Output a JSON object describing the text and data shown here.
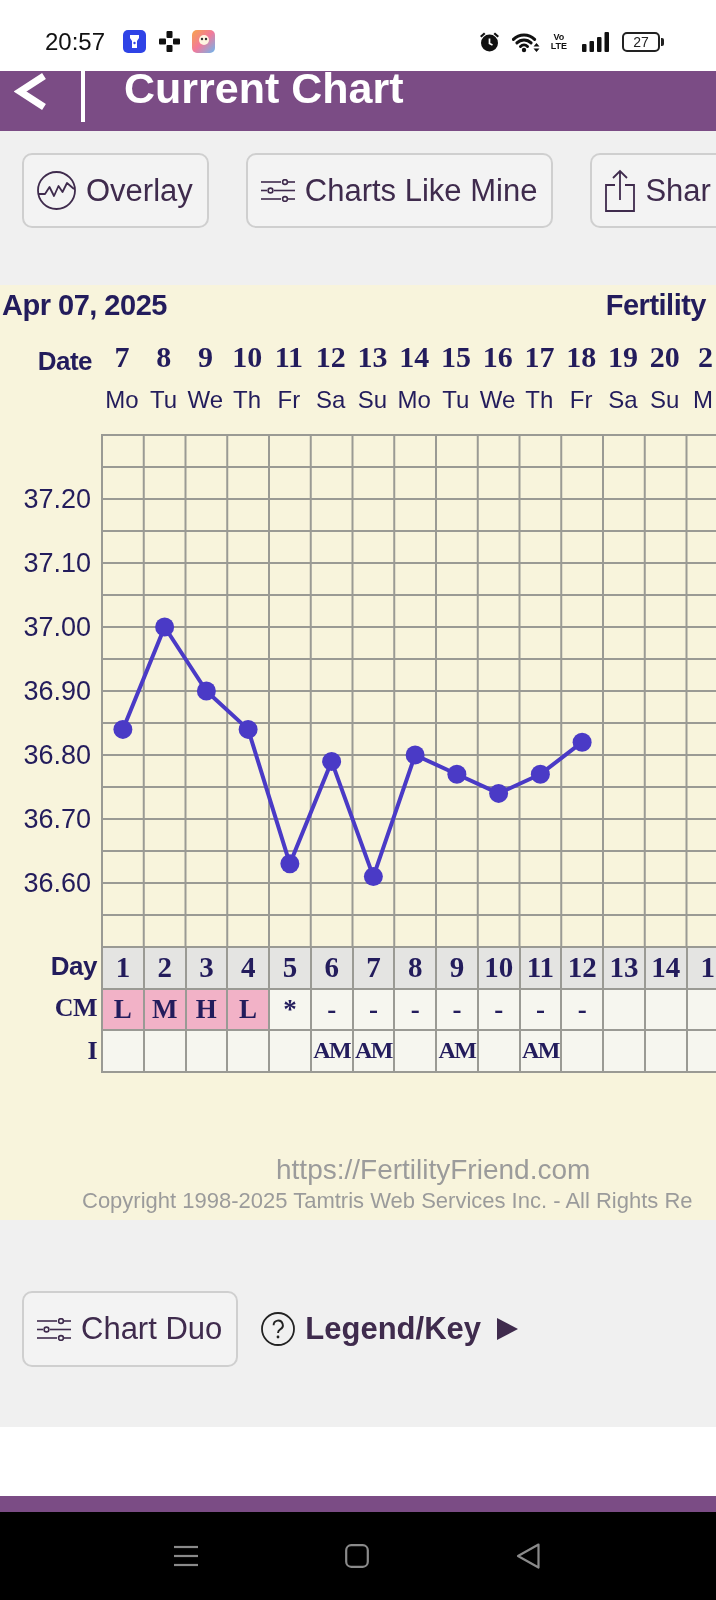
{
  "status_bar": {
    "time": "20:57",
    "network_type": [
      "Vo",
      "LTE"
    ],
    "battery": "27"
  },
  "header": {
    "title": "Current Chart"
  },
  "toolbar": [
    {
      "kind": "overlay",
      "label": "Overlay"
    },
    {
      "kind": "sliders",
      "label": "Charts Like Mine"
    },
    {
      "kind": "share",
      "label": "Shar"
    }
  ],
  "chart": {
    "date": "Apr 07, 2025",
    "brand": "Fertility",
    "date_label": "Date",
    "weekdays": [
      "Mo",
      "Tu",
      "We",
      "Th",
      "Fr",
      "Sa",
      "Su",
      "Mo",
      "Tu",
      "We",
      "Th",
      "Fr",
      "Sa",
      "Su",
      "M"
    ],
    "chart_data": {
      "type": "line",
      "grid": true,
      "categories": [
        "7",
        "8",
        "9",
        "10",
        "11",
        "12",
        "13",
        "14",
        "15",
        "16",
        "17",
        "18",
        "19",
        "20",
        "2"
      ],
      "series": [
        {
          "color": "#4a3ac6",
          "marker": true,
          "values": [
            36.84,
            37.0,
            36.9,
            36.84,
            36.63,
            36.79,
            36.61,
            36.8,
            36.77,
            36.74,
            36.77,
            36.82,
            null,
            null,
            null
          ]
        }
      ],
      "ylim": [
        36.5,
        37.3
      ],
      "yticks": [
        {
          "value": 36.6,
          "label": "36.60"
        },
        {
          "value": 36.7,
          "label": "36.70"
        },
        {
          "value": 36.8,
          "label": "36.80"
        },
        {
          "value": 36.9,
          "label": "36.90"
        },
        {
          "value": 37.0,
          "label": "37.00"
        },
        {
          "value": 37.1,
          "label": "37.10"
        },
        {
          "value": 37.2,
          "label": "37.20"
        }
      ]
    },
    "rows": [
      {
        "kind": "day",
        "label": "Day",
        "cells": [
          {
            "text": "1"
          },
          {
            "text": "2"
          },
          {
            "text": "3"
          },
          {
            "text": "4"
          },
          {
            "text": "5"
          },
          {
            "text": "6"
          },
          {
            "text": "7"
          },
          {
            "text": "8"
          },
          {
            "text": "9"
          },
          {
            "text": "10"
          },
          {
            "text": "11"
          },
          {
            "text": "12"
          },
          {
            "text": "13"
          },
          {
            "text": "14"
          },
          {
            "text": "1"
          }
        ]
      },
      {
        "kind": "cm",
        "label": "CM",
        "cells": [
          {
            "text": "L",
            "highlighted": true
          },
          {
            "text": "M",
            "highlighted": true
          },
          {
            "text": "H",
            "highlighted": true
          },
          {
            "text": "L",
            "highlighted": true
          },
          {
            "text": "*",
            "highlighted": false
          },
          {
            "text": "-",
            "highlighted": false
          },
          {
            "text": "-",
            "highlighted": false
          },
          {
            "text": "-",
            "highlighted": false
          },
          {
            "text": "-",
            "highlighted": false
          },
          {
            "text": "-",
            "highlighted": false
          },
          {
            "text": "-",
            "highlighted": false
          },
          {
            "text": "-",
            "highlighted": false
          },
          {
            "highlighted": false
          },
          {
            "highlighted": false
          },
          {
            "highlighted": false
          }
        ]
      },
      {
        "kind": "intercourse",
        "label": "I",
        "cells": [
          {},
          {},
          {},
          {},
          {},
          {
            "text": "AM"
          },
          {
            "text": "AM"
          },
          {},
          {
            "text": "AM"
          },
          {},
          {
            "text": "AM"
          },
          {},
          {},
          {},
          {}
        ]
      }
    ]
  },
  "footer": {
    "url": "https://FertilityFriend.com",
    "copyright": "Copyright 1998-2025 Tamtris Web Services Inc. - All Rights Re"
  },
  "actions": [
    {
      "kind": "button",
      "label": "Chart Duo"
    },
    {
      "kind": "link",
      "label": "Legend/Key"
    }
  ]
}
